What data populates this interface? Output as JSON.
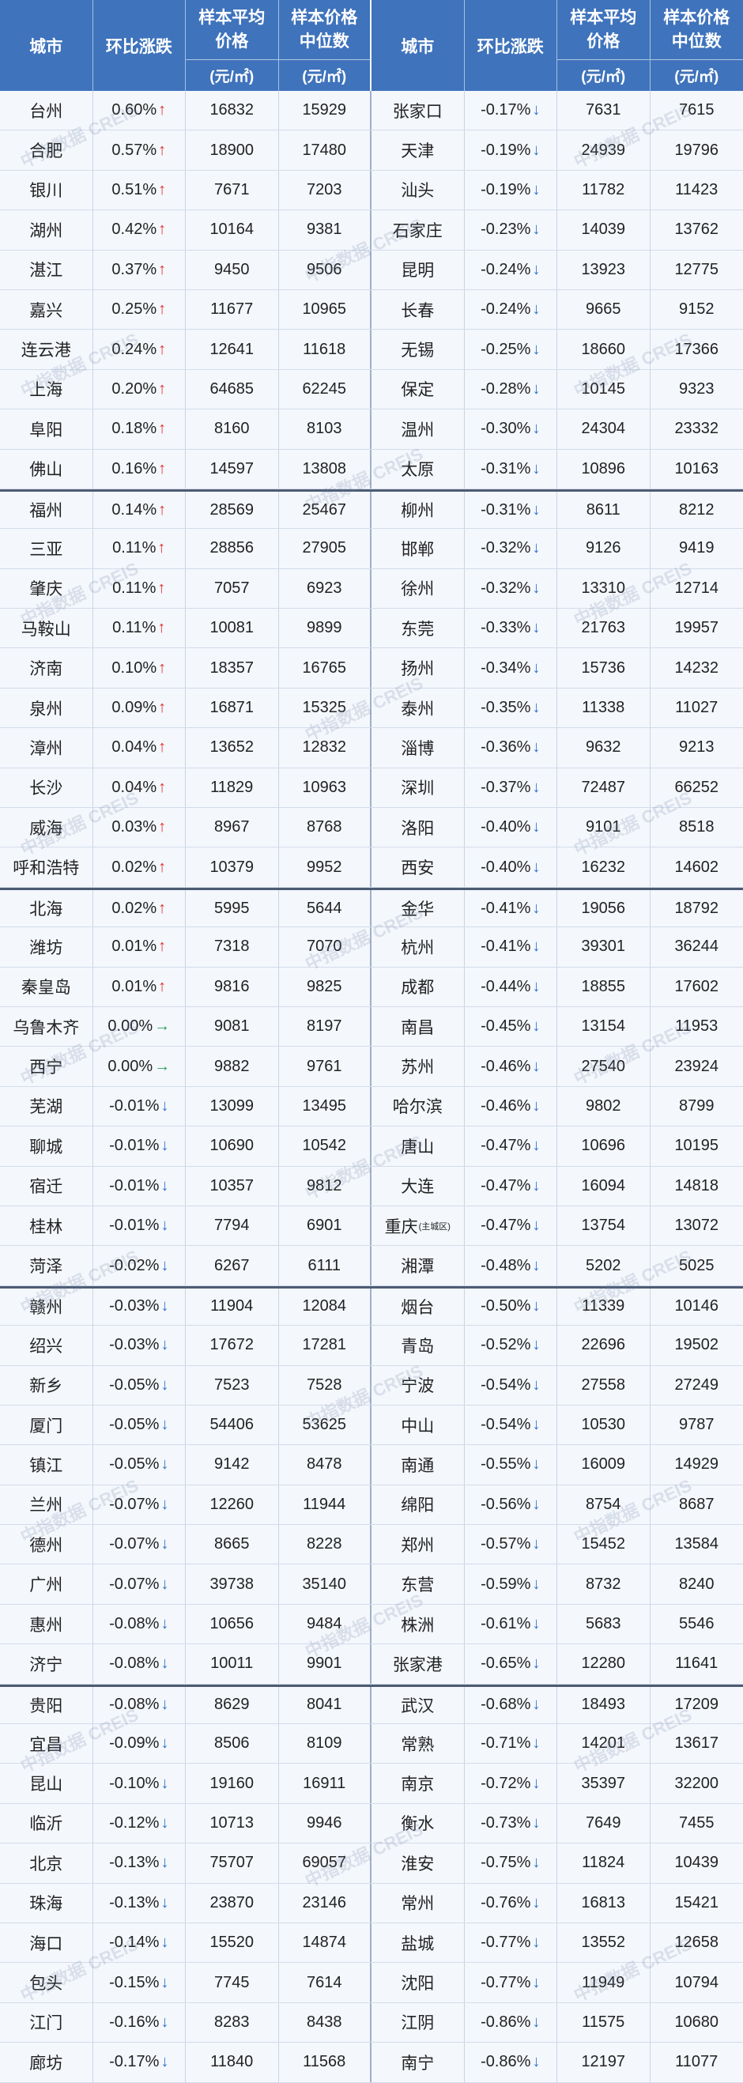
{
  "header": {
    "city": "城市",
    "change": "环比涨跌",
    "avg_price": [
      "样本平均",
      "价格"
    ],
    "median_price": [
      "样本价格",
      "中位数"
    ],
    "unit": "(元/㎡)"
  },
  "watermark": "中指数据 CREIS",
  "colors": {
    "header_bg": "#3f73bc",
    "arrow_up": "#e0302d",
    "arrow_down": "#2f73c9",
    "arrow_flat": "#2aa05a"
  },
  "rows": [
    {
      "left": {
        "city": "台州",
        "change": "0.60%",
        "arrow": "↑",
        "avg": 16832,
        "median": 15929
      },
      "right": {
        "city": "张家口",
        "change": "-0.17%",
        "arrow": "↓",
        "avg": 7631,
        "median": 7615
      }
    },
    {
      "left": {
        "city": "合肥",
        "change": "0.57%",
        "arrow": "↑",
        "avg": 18900,
        "median": 17480
      },
      "right": {
        "city": "天津",
        "change": "-0.19%",
        "arrow": "↓",
        "avg": 24939,
        "median": 19796
      }
    },
    {
      "left": {
        "city": "银川",
        "change": "0.51%",
        "arrow": "↑",
        "avg": 7671,
        "median": 7203
      },
      "right": {
        "city": "汕头",
        "change": "-0.19%",
        "arrow": "↓",
        "avg": 11782,
        "median": 11423
      }
    },
    {
      "left": {
        "city": "湖州",
        "change": "0.42%",
        "arrow": "↑",
        "avg": 10164,
        "median": 9381
      },
      "right": {
        "city": "石家庄",
        "change": "-0.23%",
        "arrow": "↓",
        "avg": 14039,
        "median": 13762
      }
    },
    {
      "left": {
        "city": "湛江",
        "change": "0.37%",
        "arrow": "↑",
        "avg": 9450,
        "median": 9506
      },
      "right": {
        "city": "昆明",
        "change": "-0.24%",
        "arrow": "↓",
        "avg": 13923,
        "median": 12775
      }
    },
    {
      "left": {
        "city": "嘉兴",
        "change": "0.25%",
        "arrow": "↑",
        "avg": 11677,
        "median": 10965
      },
      "right": {
        "city": "长春",
        "change": "-0.24%",
        "arrow": "↓",
        "avg": 9665,
        "median": 9152
      }
    },
    {
      "left": {
        "city": "连云港",
        "change": "0.24%",
        "arrow": "↑",
        "avg": 12641,
        "median": 11618
      },
      "right": {
        "city": "无锡",
        "change": "-0.25%",
        "arrow": "↓",
        "avg": 18660,
        "median": 17366
      }
    },
    {
      "left": {
        "city": "上海",
        "change": "0.20%",
        "arrow": "↑",
        "avg": 64685,
        "median": 62245
      },
      "right": {
        "city": "保定",
        "change": "-0.28%",
        "arrow": "↓",
        "avg": 10145,
        "median": 9323
      }
    },
    {
      "left": {
        "city": "阜阳",
        "change": "0.18%",
        "arrow": "↑",
        "avg": 8160,
        "median": 8103
      },
      "right": {
        "city": "温州",
        "change": "-0.30%",
        "arrow": "↓",
        "avg": 24304,
        "median": 23332
      }
    },
    {
      "left": {
        "city": "佛山",
        "change": "0.16%",
        "arrow": "↑",
        "avg": 14597,
        "median": 13808
      },
      "right": {
        "city": "太原",
        "change": "-0.31%",
        "arrow": "↓",
        "avg": 10896,
        "median": 10163
      }
    },
    {
      "left": {
        "city": "福州",
        "change": "0.14%",
        "arrow": "↑",
        "avg": 28569,
        "median": 25467
      },
      "right": {
        "city": "柳州",
        "change": "-0.31%",
        "arrow": "↓",
        "avg": 8611,
        "median": 8212
      }
    },
    {
      "left": {
        "city": "三亚",
        "change": "0.11%",
        "arrow": "↑",
        "avg": 28856,
        "median": 27905
      },
      "right": {
        "city": "邯郸",
        "change": "-0.32%",
        "arrow": "↓",
        "avg": 9126,
        "median": 9419
      }
    },
    {
      "left": {
        "city": "肇庆",
        "change": "0.11%",
        "arrow": "↑",
        "avg": 7057,
        "median": 6923
      },
      "right": {
        "city": "徐州",
        "change": "-0.32%",
        "arrow": "↓",
        "avg": 13310,
        "median": 12714
      }
    },
    {
      "left": {
        "city": "马鞍山",
        "change": "0.11%",
        "arrow": "↑",
        "avg": 10081,
        "median": 9899
      },
      "right": {
        "city": "东莞",
        "change": "-0.33%",
        "arrow": "↓",
        "avg": 21763,
        "median": 19957
      }
    },
    {
      "left": {
        "city": "济南",
        "change": "0.10%",
        "arrow": "↑",
        "avg": 18357,
        "median": 16765
      },
      "right": {
        "city": "扬州",
        "change": "-0.34%",
        "arrow": "↓",
        "avg": 15736,
        "median": 14232
      }
    },
    {
      "left": {
        "city": "泉州",
        "change": "0.09%",
        "arrow": "↑",
        "avg": 16871,
        "median": 15325
      },
      "right": {
        "city": "泰州",
        "change": "-0.35%",
        "arrow": "↓",
        "avg": 11338,
        "median": 11027
      }
    },
    {
      "left": {
        "city": "漳州",
        "change": "0.04%",
        "arrow": "↑",
        "avg": 13652,
        "median": 12832
      },
      "right": {
        "city": "淄博",
        "change": "-0.36%",
        "arrow": "↓",
        "avg": 9632,
        "median": 9213
      }
    },
    {
      "left": {
        "city": "长沙",
        "change": "0.04%",
        "arrow": "↑",
        "avg": 11829,
        "median": 10963
      },
      "right": {
        "city": "深圳",
        "change": "-0.37%",
        "arrow": "↓",
        "avg": 72487,
        "median": 66252
      }
    },
    {
      "left": {
        "city": "威海",
        "change": "0.03%",
        "arrow": "↑",
        "avg": 8967,
        "median": 8768
      },
      "right": {
        "city": "洛阳",
        "change": "-0.40%",
        "arrow": "↓",
        "avg": 9101,
        "median": 8518
      }
    },
    {
      "left": {
        "city": "呼和浩特",
        "change": "0.02%",
        "arrow": "↑",
        "avg": 10379,
        "median": 9952
      },
      "right": {
        "city": "西安",
        "change": "-0.40%",
        "arrow": "↓",
        "avg": 16232,
        "median": 14602
      }
    },
    {
      "left": {
        "city": "北海",
        "change": "0.02%",
        "arrow": "↑",
        "avg": 5995,
        "median": 5644
      },
      "right": {
        "city": "金华",
        "change": "-0.41%",
        "arrow": "↓",
        "avg": 19056,
        "median": 18792
      }
    },
    {
      "left": {
        "city": "潍坊",
        "change": "0.01%",
        "arrow": "↑",
        "avg": 7318,
        "median": 7070
      },
      "right": {
        "city": "杭州",
        "change": "-0.41%",
        "arrow": "↓",
        "avg": 39301,
        "median": 36244
      }
    },
    {
      "left": {
        "city": "秦皇岛",
        "change": "0.01%",
        "arrow": "↑",
        "avg": 9816,
        "median": 9825
      },
      "right": {
        "city": "成都",
        "change": "-0.44%",
        "arrow": "↓",
        "avg": 18855,
        "median": 17602
      }
    },
    {
      "left": {
        "city": "乌鲁木齐",
        "change": "0.00%",
        "arrow": "→",
        "avg": 9081,
        "median": 8197
      },
      "right": {
        "city": "南昌",
        "change": "-0.45%",
        "arrow": "↓",
        "avg": 13154,
        "median": 11953
      }
    },
    {
      "left": {
        "city": "西宁",
        "change": "0.00%",
        "arrow": "→",
        "avg": 9882,
        "median": 9761
      },
      "right": {
        "city": "苏州",
        "change": "-0.46%",
        "arrow": "↓",
        "avg": 27540,
        "median": 23924
      }
    },
    {
      "left": {
        "city": "芜湖",
        "change": "-0.01%",
        "arrow": "↓",
        "avg": 13099,
        "median": 13495
      },
      "right": {
        "city": "哈尔滨",
        "change": "-0.46%",
        "arrow": "↓",
        "avg": 9802,
        "median": 8799
      }
    },
    {
      "left": {
        "city": "聊城",
        "change": "-0.01%",
        "arrow": "↓",
        "avg": 10690,
        "median": 10542
      },
      "right": {
        "city": "唐山",
        "change": "-0.47%",
        "arrow": "↓",
        "avg": 10696,
        "median": 10195
      }
    },
    {
      "left": {
        "city": "宿迁",
        "change": "-0.01%",
        "arrow": "↓",
        "avg": 10357,
        "median": 9812
      },
      "right": {
        "city": "大连",
        "change": "-0.47%",
        "arrow": "↓",
        "avg": 16094,
        "median": 14818
      }
    },
    {
      "left": {
        "city": "桂林",
        "change": "-0.01%",
        "arrow": "↓",
        "avg": 7794,
        "median": 6901
      },
      "right": {
        "city": "重庆",
        "city_note": "(主城区)",
        "change": "-0.47%",
        "arrow": "↓",
        "avg": 13754,
        "median": 13072
      }
    },
    {
      "left": {
        "city": "菏泽",
        "change": "-0.02%",
        "arrow": "↓",
        "avg": 6267,
        "median": 6111
      },
      "right": {
        "city": "湘潭",
        "change": "-0.48%",
        "arrow": "↓",
        "avg": 5202,
        "median": 5025
      }
    },
    {
      "left": {
        "city": "赣州",
        "change": "-0.03%",
        "arrow": "↓",
        "avg": 11904,
        "median": 12084
      },
      "right": {
        "city": "烟台",
        "change": "-0.50%",
        "arrow": "↓",
        "avg": 11339,
        "median": 10146
      }
    },
    {
      "left": {
        "city": "绍兴",
        "change": "-0.03%",
        "arrow": "↓",
        "avg": 17672,
        "median": 17281
      },
      "right": {
        "city": "青岛",
        "change": "-0.52%",
        "arrow": "↓",
        "avg": 22696,
        "median": 19502
      }
    },
    {
      "left": {
        "city": "新乡",
        "change": "-0.05%",
        "arrow": "↓",
        "avg": 7523,
        "median": 7528
      },
      "right": {
        "city": "宁波",
        "change": "-0.54%",
        "arrow": "↓",
        "avg": 27558,
        "median": 27249
      }
    },
    {
      "left": {
        "city": "厦门",
        "change": "-0.05%",
        "arrow": "↓",
        "avg": 54406,
        "median": 53625
      },
      "right": {
        "city": "中山",
        "change": "-0.54%",
        "arrow": "↓",
        "avg": 10530,
        "median": 9787
      }
    },
    {
      "left": {
        "city": "镇江",
        "change": "-0.05%",
        "arrow": "↓",
        "avg": 9142,
        "median": 8478
      },
      "right": {
        "city": "南通",
        "change": "-0.55%",
        "arrow": "↓",
        "avg": 16009,
        "median": 14929
      }
    },
    {
      "left": {
        "city": "兰州",
        "change": "-0.07%",
        "arrow": "↓",
        "avg": 12260,
        "median": 11944
      },
      "right": {
        "city": "绵阳",
        "change": "-0.56%",
        "arrow": "↓",
        "avg": 8754,
        "median": 8687
      }
    },
    {
      "left": {
        "city": "德州",
        "change": "-0.07%",
        "arrow": "↓",
        "avg": 8665,
        "median": 8228
      },
      "right": {
        "city": "郑州",
        "change": "-0.57%",
        "arrow": "↓",
        "avg": 15452,
        "median": 13584
      }
    },
    {
      "left": {
        "city": "广州",
        "change": "-0.07%",
        "arrow": "↓",
        "avg": 39738,
        "median": 35140
      },
      "right": {
        "city": "东营",
        "change": "-0.59%",
        "arrow": "↓",
        "avg": 8732,
        "median": 8240
      }
    },
    {
      "left": {
        "city": "惠州",
        "change": "-0.08%",
        "arrow": "↓",
        "avg": 10656,
        "median": 9484
      },
      "right": {
        "city": "株洲",
        "change": "-0.61%",
        "arrow": "↓",
        "avg": 5683,
        "median": 5546
      }
    },
    {
      "left": {
        "city": "济宁",
        "change": "-0.08%",
        "arrow": "↓",
        "avg": 10011,
        "median": 9901
      },
      "right": {
        "city": "张家港",
        "change": "-0.65%",
        "arrow": "↓",
        "avg": 12280,
        "median": 11641
      }
    },
    {
      "left": {
        "city": "贵阳",
        "change": "-0.08%",
        "arrow": "↓",
        "avg": 8629,
        "median": 8041
      },
      "right": {
        "city": "武汉",
        "change": "-0.68%",
        "arrow": "↓",
        "avg": 18493,
        "median": 17209
      }
    },
    {
      "left": {
        "city": "宜昌",
        "change": "-0.09%",
        "arrow": "↓",
        "avg": 8506,
        "median": 8109
      },
      "right": {
        "city": "常熟",
        "change": "-0.71%",
        "arrow": "↓",
        "avg": 14201,
        "median": 13617
      }
    },
    {
      "left": {
        "city": "昆山",
        "change": "-0.10%",
        "arrow": "↓",
        "avg": 19160,
        "median": 16911
      },
      "right": {
        "city": "南京",
        "change": "-0.72%",
        "arrow": "↓",
        "avg": 35397,
        "median": 32200
      }
    },
    {
      "left": {
        "city": "临沂",
        "change": "-0.12%",
        "arrow": "↓",
        "avg": 10713,
        "median": 9946
      },
      "right": {
        "city": "衡水",
        "change": "-0.73%",
        "arrow": "↓",
        "avg": 7649,
        "median": 7455
      }
    },
    {
      "left": {
        "city": "北京",
        "change": "-0.13%",
        "arrow": "↓",
        "avg": 75707,
        "median": 69057
      },
      "right": {
        "city": "淮安",
        "change": "-0.75%",
        "arrow": "↓",
        "avg": 11824,
        "median": 10439
      }
    },
    {
      "left": {
        "city": "珠海",
        "change": "-0.13%",
        "arrow": "↓",
        "avg": 23870,
        "median": 23146
      },
      "right": {
        "city": "常州",
        "change": "-0.76%",
        "arrow": "↓",
        "avg": 16813,
        "median": 15421
      }
    },
    {
      "left": {
        "city": "海口",
        "change": "-0.14%",
        "arrow": "↓",
        "avg": 15520,
        "median": 14874
      },
      "right": {
        "city": "盐城",
        "change": "-0.77%",
        "arrow": "↓",
        "avg": 13552,
        "median": 12658
      }
    },
    {
      "left": {
        "city": "包头",
        "change": "-0.15%",
        "arrow": "↓",
        "avg": 7745,
        "median": 7614
      },
      "right": {
        "city": "沈阳",
        "change": "-0.77%",
        "arrow": "↓",
        "avg": 11949,
        "median": 10794
      }
    },
    {
      "left": {
        "city": "江门",
        "change": "-0.16%",
        "arrow": "↓",
        "avg": 8283,
        "median": 8438
      },
      "right": {
        "city": "江阴",
        "change": "-0.86%",
        "arrow": "↓",
        "avg": 11575,
        "median": 10680
      }
    },
    {
      "left": {
        "city": "廊坊",
        "change": "-0.17%",
        "arrow": "↓",
        "avg": 11840,
        "median": 11568
      },
      "right": {
        "city": "南宁",
        "change": "-0.86%",
        "arrow": "↓",
        "avg": 12197,
        "median": 11077
      }
    }
  ]
}
